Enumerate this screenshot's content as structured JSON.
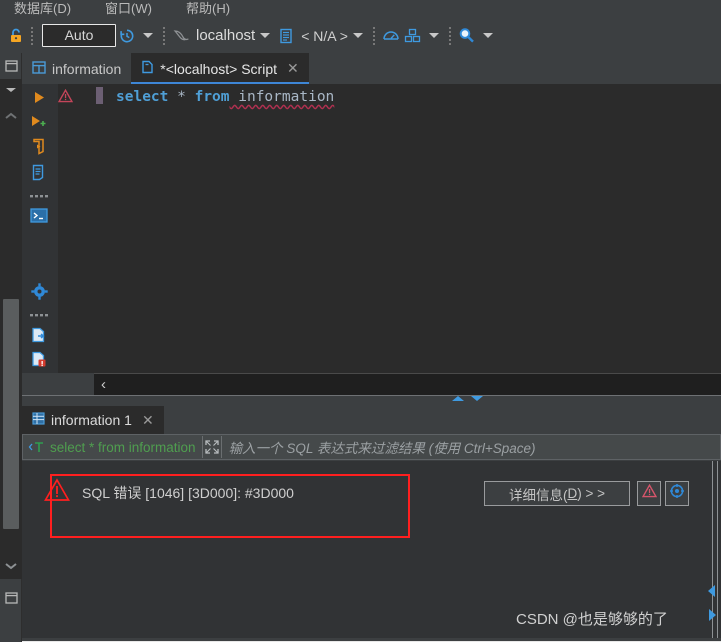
{
  "menubar": {
    "items": [
      {
        "label": "数据库(D)",
        "name": "menu-database"
      },
      {
        "label": "窗口(W)",
        "name": "menu-window"
      },
      {
        "label": "帮助(H)",
        "name": "menu-help"
      }
    ]
  },
  "toolbar": {
    "lock_icon": "lock-icon",
    "auto_commit_value": "Auto",
    "history_icon": "history-clock-icon",
    "datasource_icon": "mysql-dolphin-icon",
    "datasource_name": "localhost",
    "schema_icon": "schema-icon",
    "schema_name": "< N/A >",
    "cloud_icon": "cloud-icon",
    "gauge_icon": "gauge-icon",
    "package_icon": "package-icon",
    "search_icon": "search-icon"
  },
  "editor_tabs": [
    {
      "label": "information",
      "icon": "table-icon",
      "active": false,
      "closable": false
    },
    {
      "label": "*<localhost> Script",
      "icon": "script-icon",
      "active": true,
      "closable": true,
      "close_label": "✕"
    }
  ],
  "gutter_icons": [
    {
      "name": "run-icon"
    },
    {
      "name": "run-new-icon"
    },
    {
      "name": "execute-script-icon"
    },
    {
      "name": "script-file-icon"
    },
    {
      "name": "more-dots-icon"
    },
    {
      "name": "console-icon"
    },
    {
      "name": "settings-gear-icon"
    },
    {
      "name": "more-dots-icon-2"
    },
    {
      "name": "export-file-icon"
    },
    {
      "name": "error-file-icon"
    },
    {
      "name": "data-file-icon"
    }
  ],
  "editor": {
    "warning_icon": "warning-triangle-icon",
    "run_icon": "run-arrow-icon",
    "code": {
      "kw_select": "select",
      "op_star": " * ",
      "kw_from": "from",
      "ident": " information"
    },
    "scrollbar_chevron": "‹"
  },
  "results": {
    "tab_label": "information 1",
    "tab_icon": "grid-icon",
    "tab_close": "✕",
    "filter": {
      "type_icon": "sql-filter-icon",
      "value": "select * from information",
      "expand_icon": "expand-icon",
      "placeholder": "输入一个 SQL 表达式来过滤结果 (使用 Ctrl+Space)"
    },
    "error": {
      "icon": "error-triangle-icon",
      "message": "SQL 错误 [1046] [3D000]: #3D000",
      "border_color": "#ff1f1f"
    },
    "detail_button": {
      "prefix": "详细信息(",
      "mnemonic": "D",
      "suffix": ") > >"
    },
    "warn_button_icon": "warning-triangle-icon",
    "bug_button_icon": "target-bug-icon"
  },
  "rail": {
    "top_icon": "panel-toggle-icon",
    "caret_down": "chevron-down-icon",
    "chevron_up": "chevron-up-icon",
    "chevron_down": "chevron-down-icon-2",
    "bottom_icon": "panel-toggle-icon-2"
  },
  "watermark": "CSDN @也是够够的了",
  "colors": {
    "accent_blue": "#3e86d6",
    "error_red": "#ff1f1f",
    "keyword_blue": "#4f9fd6",
    "filter_green": "#4f9e4f",
    "bg_dark": "#2b2b2b",
    "bg_chrome": "#3c3f41"
  }
}
